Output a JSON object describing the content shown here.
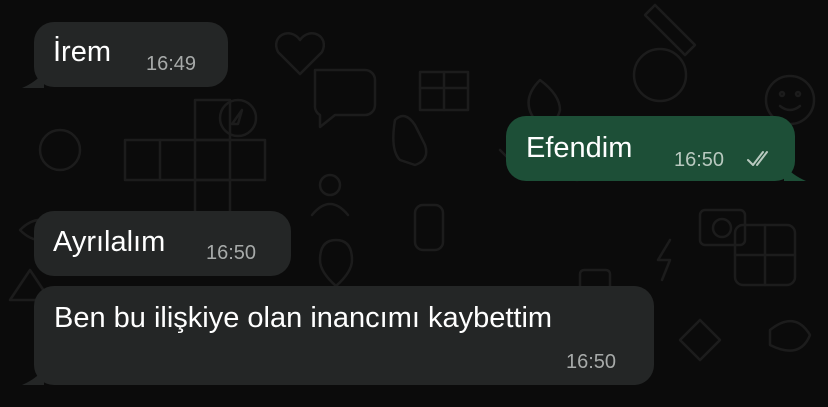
{
  "chat": {
    "messages": [
      {
        "direction": "incoming",
        "text": "İrem",
        "time": "16:49"
      },
      {
        "direction": "outgoing",
        "text": "Efendim",
        "time": "16:50",
        "status": "read-double-check"
      },
      {
        "direction": "incoming",
        "text": "Ayrılalım",
        "time": "16:50"
      },
      {
        "direction": "incoming",
        "text": "Ben bu ilişkiye olan inancımı kaybettim",
        "time": "16:50"
      }
    ]
  },
  "colors": {
    "background": "#0b0b0b",
    "incoming_bubble": "#242626",
    "outgoing_bubble": "#1d4f37",
    "text": "#ffffff",
    "timestamp": "#a7aaa9"
  }
}
